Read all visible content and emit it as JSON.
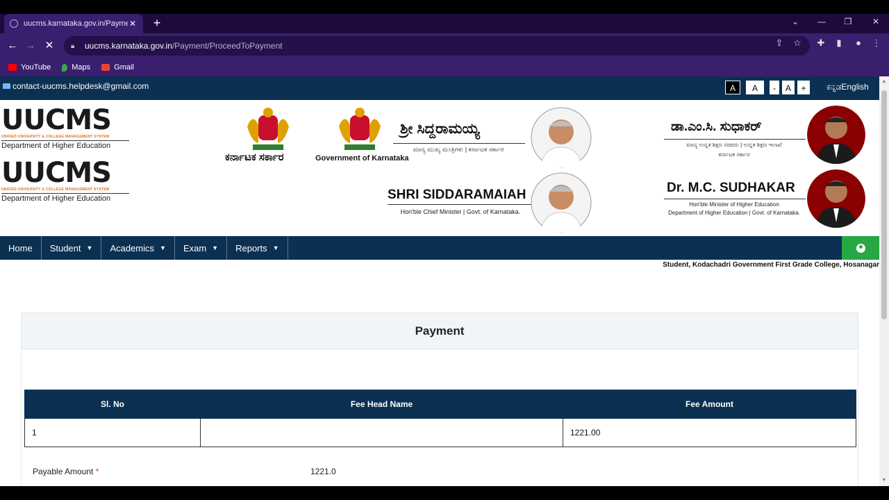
{
  "browser": {
    "tab_title": "uucms.karnataka.gov.in/Payment/",
    "url_host": "uucms.karnataka.gov.in",
    "url_path": "/Payment/ProceedToPayment",
    "bookmarks": [
      {
        "label": "YouTube",
        "icon": "youtube-icon",
        "color": "#ff0000"
      },
      {
        "label": "Maps",
        "icon": "maps-icon",
        "color": "#34a853"
      },
      {
        "label": "Gmail",
        "icon": "gmail-icon",
        "color": "#ea4335"
      }
    ]
  },
  "topstrip": {
    "contact": "contact-uucms.helpdesk@gmail.com",
    "font_buttons": [
      "A",
      "A",
      "-",
      "A",
      "+"
    ],
    "language": "ಕನ್ನಡEnglish"
  },
  "header": {
    "logo_text": "UUCMS",
    "logo_sub": "UNIFIED UNIVERSITY & COLLEGE MANAGEMENT SYSTEM",
    "logo_dept": "Department of Higher Education",
    "karnataka_sarkara": "ಕರ್ನಾಟಕ ಸರ್ಕಾರ",
    "gok": "Government of Karnataka",
    "cm_kannada": "ಶ್ರೀ ಸಿದ್ದರಾಮಯ್ಯ",
    "cm_kannada_sub": "ಮಾನ್ಯ ಮುಖ್ಯ ಮಂತ್ರಿಗಳು  |  ಕರ್ನಾಟಕ ಸರ್ಕಾರ",
    "cm_name": "SHRI SIDDARAMAIAH",
    "cm_sub": "Hon'ble Chief Minister  |  Govt. of Karnataka.",
    "min_kannada": "ಡಾ.ಎಂ.ಸಿ. ಸುಧಾಕರ್",
    "min_kannada_sub": "ಮಾನ್ಯ ಉನ್ನತ ಶಿಕ್ಷಣ ಸಚಿವರು | ಉನ್ನತ ಶಿಕ್ಷಣ ಇಲಾಖೆ",
    "min_kannada_sub2": "ಕರ್ನಾಟಕ ಸರ್ಕಾರ",
    "min_name": "Dr. M.C. SUDHAKAR",
    "min_sub": "Hon'ble Minister of Higher Education",
    "min_sub2": "Department of Higher Education | Govt. of Karnataka."
  },
  "nav": {
    "items": [
      {
        "label": "Home",
        "dropdown": false
      },
      {
        "label": "Student",
        "dropdown": true
      },
      {
        "label": "Academics",
        "dropdown": true
      },
      {
        "label": "Exam",
        "dropdown": true
      },
      {
        "label": "Reports",
        "dropdown": true
      }
    ],
    "student_info": "Student, Kodachadri Government First Grade College, Hosanagar"
  },
  "payment": {
    "title": "Payment",
    "columns": [
      "Sl. No",
      "Fee Head Name",
      "Fee Amount"
    ],
    "rows": [
      {
        "sl": "1",
        "head": "",
        "amount": "1221.00"
      }
    ],
    "payable_label": "Payable Amount",
    "required_mark": "*",
    "payable_value": "1221.0"
  }
}
